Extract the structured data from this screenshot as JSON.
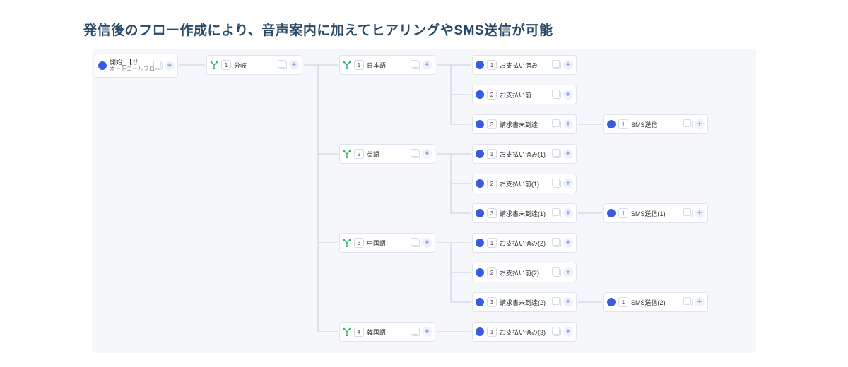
{
  "title": "発信後のフロー作成により、音声案内に加えてヒアリングやSMS送信が可能",
  "start": {
    "label": "開始_【サンプル】I社",
    "sublabel": "オートコールフロー"
  },
  "branch": {
    "num": "1",
    "label": "分岐"
  },
  "languages": [
    {
      "num": "1",
      "label": "日本語"
    },
    {
      "num": "2",
      "label": "英語"
    },
    {
      "num": "3",
      "label": "中国語"
    },
    {
      "num": "4",
      "label": "韓国語"
    }
  ],
  "options_jp": [
    {
      "num": "1",
      "label": "お支払い済み"
    },
    {
      "num": "2",
      "label": "お支払い前"
    },
    {
      "num": "3",
      "label": "請求書未到達"
    }
  ],
  "options_en": [
    {
      "num": "1",
      "label": "お支払い済み(1)"
    },
    {
      "num": "2",
      "label": "お支払い前(1)"
    },
    {
      "num": "3",
      "label": "請求書未到達(1)"
    }
  ],
  "options_cn": [
    {
      "num": "1",
      "label": "お支払い済み(2)"
    },
    {
      "num": "2",
      "label": "お支払い前(2)"
    },
    {
      "num": "3",
      "label": "請求書未到達(2)"
    }
  ],
  "options_kr": [
    {
      "num": "1",
      "label": "お支払い済み(3)"
    }
  ],
  "sms": [
    {
      "num": "1",
      "label": "SMS送信"
    },
    {
      "num": "1",
      "label": "SMS送信(1)"
    },
    {
      "num": "1",
      "label": "SMS送信(2)"
    }
  ]
}
